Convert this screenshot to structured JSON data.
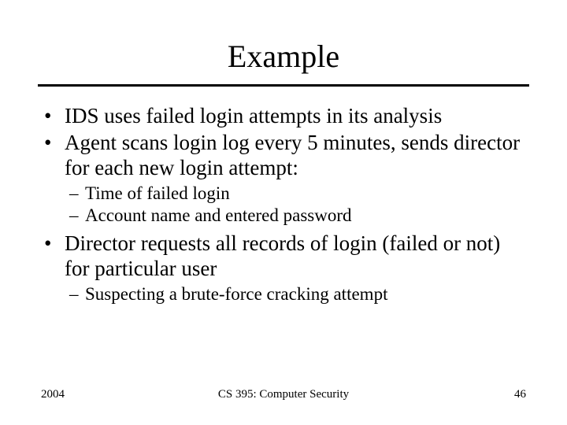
{
  "title": "Example",
  "bullets": [
    {
      "text": "IDS uses failed login attempts in its analysis",
      "subs": []
    },
    {
      "text": "Agent scans login log every 5 minutes, sends director for each new login attempt:",
      "subs": [
        "Time of failed login",
        "Account name and entered password"
      ]
    },
    {
      "text": "Director requests all records of login (failed or not) for particular user",
      "subs": [
        "Suspecting a brute-force cracking attempt"
      ]
    }
  ],
  "footer": {
    "left": "2004",
    "center": "CS 395: Computer Security",
    "right": "46"
  }
}
